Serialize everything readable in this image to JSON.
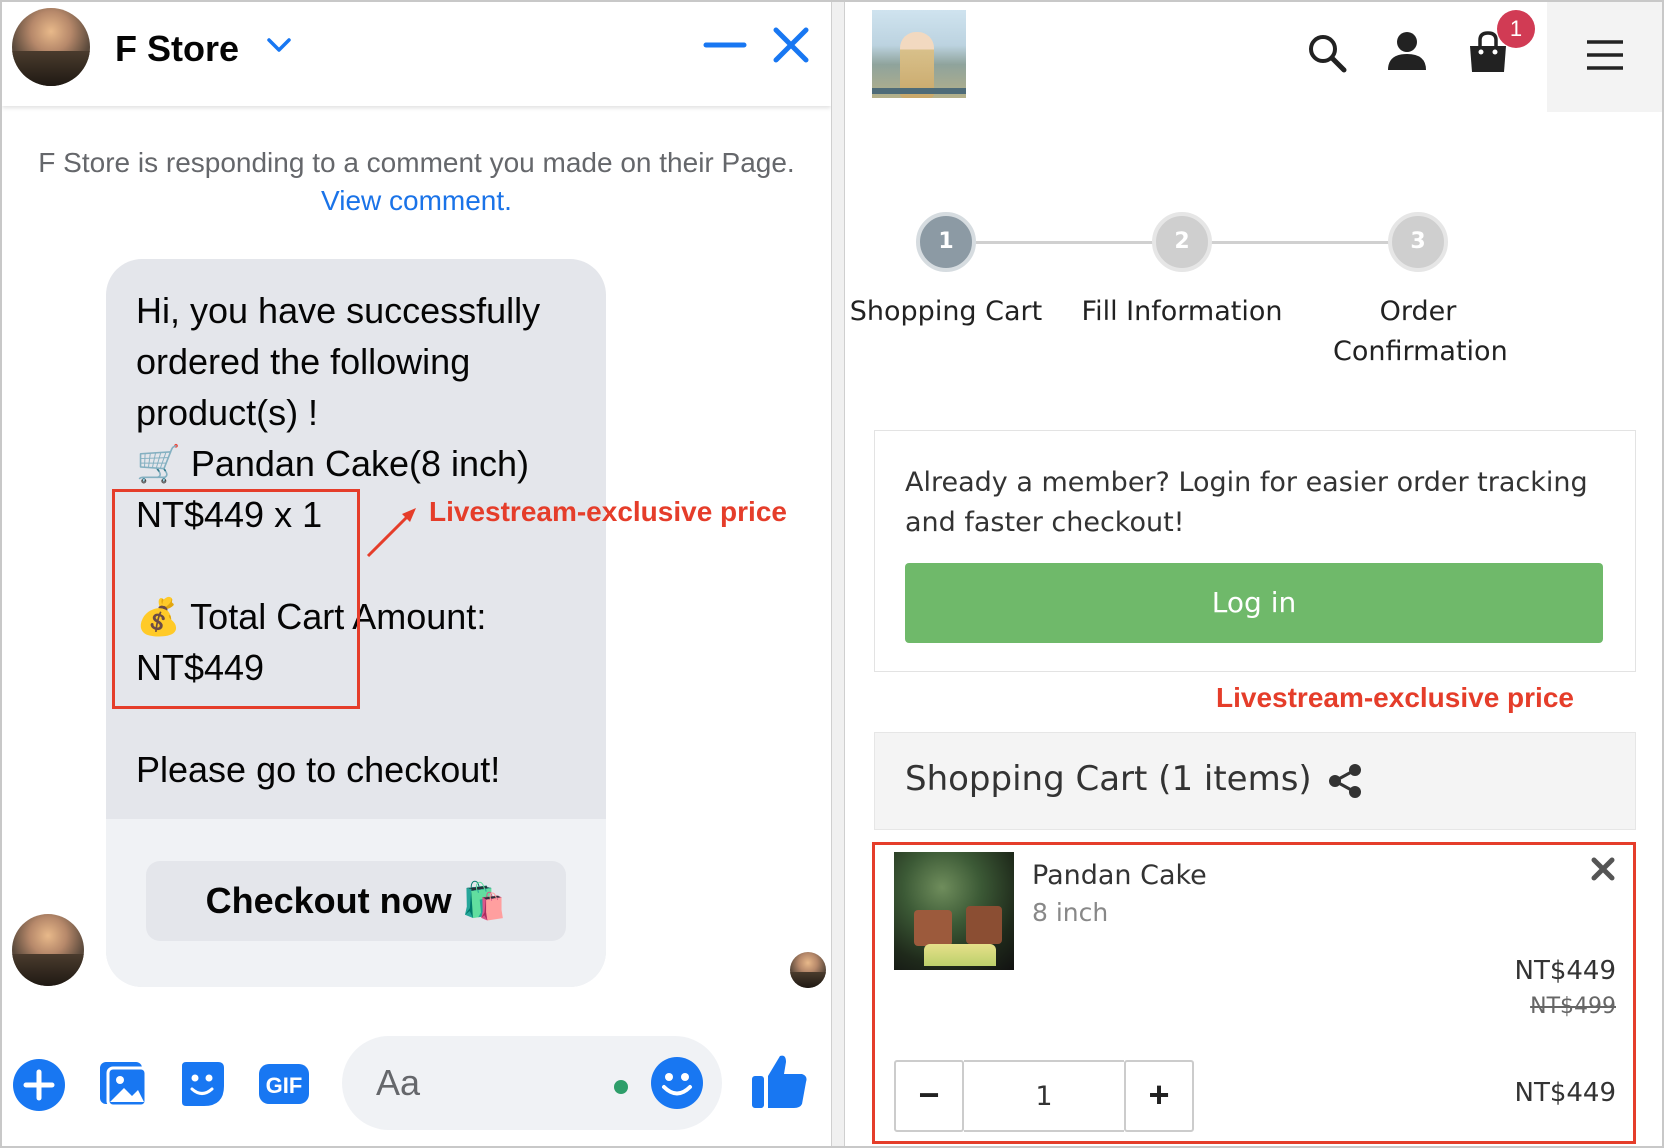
{
  "chat": {
    "store_name": "F Store",
    "notice_text": "F Store is responding to a comment you made on their Page.",
    "notice_link": "View comment.",
    "message": "Hi, you have successfully ordered the following product(s) !\n🛒 Pandan Cake(8 inch)\nNT$449 x 1\n\n💰 Total Cart Amount:\nNT$449\n\nPlease go to checkout!",
    "checkout_button": "Checkout now 🛍️",
    "composer_placeholder": "Aa",
    "annotation": "Livestream-exclusive price"
  },
  "store": {
    "cart_badge": "1",
    "steps": [
      {
        "number": "1",
        "label": "Shopping Cart",
        "state": "active"
      },
      {
        "number": "2",
        "label": "Fill Information",
        "state": "todo"
      },
      {
        "number": "3",
        "label": "Order Confirmation",
        "state": "todo"
      }
    ],
    "member_prompt": "Already a member? Login for easier order tracking and faster checkout!",
    "login_button": "Log in",
    "annotation": "Livestream-exclusive price",
    "cart_title": "Shopping Cart  (1 items)",
    "item": {
      "name": "Pandan Cake",
      "variant": "8 inch",
      "price": "NT$449",
      "original_price": "NT$499",
      "quantity": "1",
      "subtotal": "NT$449"
    }
  },
  "colors": {
    "messenger_blue": "#1877f2",
    "annotation_red": "#e53d2a",
    "login_green": "#6fb96a",
    "badge_red": "#d13b54",
    "step_active": "#8c9aa4"
  },
  "icons": [
    "chevron-down-icon",
    "minimize-icon",
    "close-icon",
    "plus-circle-icon",
    "image-icon",
    "sticker-icon",
    "gif-icon",
    "emoji-icon",
    "like-icon",
    "search-icon",
    "user-icon",
    "cart-icon",
    "menu-icon",
    "share-icon",
    "remove-icon"
  ]
}
